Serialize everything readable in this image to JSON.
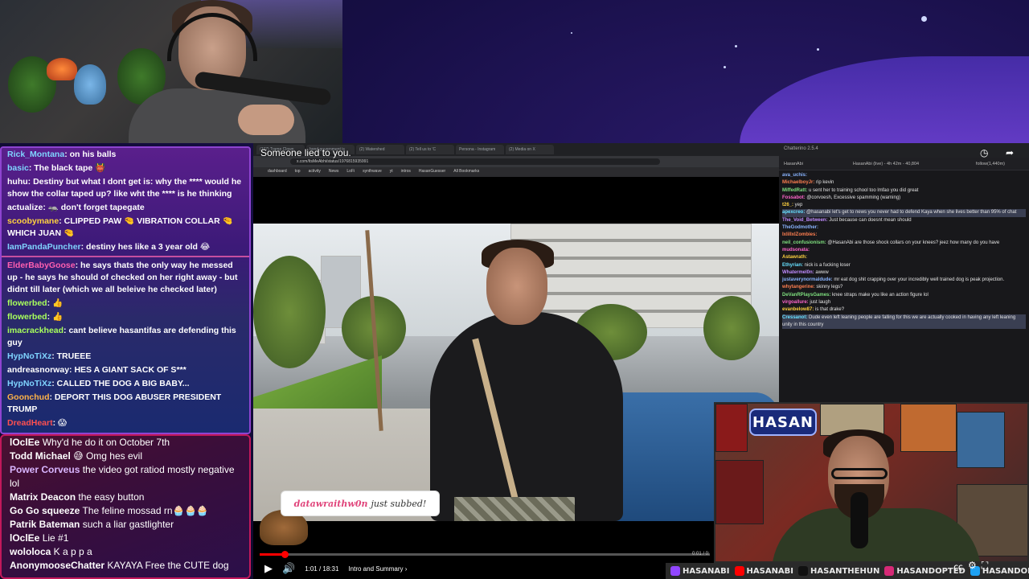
{
  "stream": {
    "video_title_overlay": "Someone lied to you."
  },
  "chat_left": {
    "messages": [
      {
        "user": "Rick_Montana",
        "color": "#7fd4ff",
        "text": "on his balls"
      },
      {
        "user": "basic",
        "color": "#7fd4ff",
        "text": "The black tape 👹"
      },
      {
        "user": "huhu",
        "color": "#ffffff",
        "text": "Destiny but what I dont get is: why the **** would he show the collar taped up? like wht the **** is he thinking"
      },
      {
        "user": "actualize",
        "color": "#ffffff",
        "text": "🦡 don't forget tapegate"
      },
      {
        "user": "scoobymane",
        "color": "#ffd23f",
        "text": "CLIPPED PAW 🤏 VIBRATION COLLAR 🤏 WHICH JUAN 🤏"
      },
      {
        "user": "IamPandaPuncher",
        "color": "#7fd4ff",
        "text": "destiny hes like a 3 year old 😂"
      },
      {
        "user": "ElderBabyGoose",
        "color": "#ff5fb0",
        "text": "he says thats the only way he messed up - he says he should of checked on her right away - but didnt till later (which we all beleive he checked later)"
      },
      {
        "user": "flowerbed",
        "color": "#a8ff5c",
        "text": "👍"
      },
      {
        "user": "flowerbed",
        "color": "#a8ff5c",
        "text": "👍"
      },
      {
        "user": "imacrackhead",
        "color": "#a8ff5c",
        "text": "cant believe hasantifas are defending this guy"
      },
      {
        "user": "HypNoTiXz",
        "color": "#7fd4ff",
        "text": "TRUEEE"
      },
      {
        "user": "andreasnorway",
        "color": "#ffffff",
        "text": "HES A GIANT SACK OF S***"
      },
      {
        "user": "HypNoTiXz",
        "color": "#7fd4ff",
        "text": "CALLED THE DOG A BIG BABY..."
      },
      {
        "user": "Goonchud",
        "color": "#ffb347",
        "text": "DEPORT THIS DOG ABUSER PRESIDENT TRUMP"
      },
      {
        "user": "DreadHeart",
        "color": "#ff5050",
        "text": "😱"
      }
    ]
  },
  "chat_bottom_left": {
    "messages": [
      {
        "user": "lOclEe",
        "color": "#ffffff",
        "text": "Why'd he do it on October 7th"
      },
      {
        "user": "Todd Michael",
        "color": "#ffffff",
        "text": "😅 Omg hes evil"
      },
      {
        "user": "Power Corveus",
        "color": "#d9b6ff",
        "text": "the video got ratiod mostly negative lol"
      },
      {
        "user": "Matrix Deacon",
        "color": "#ffffff",
        "text": "the easy button"
      },
      {
        "user": "Go Go squeeze",
        "color": "#ffffff",
        "text": "The feline mossad rn🧁🧁🧁"
      },
      {
        "user": "Patrik Bateman",
        "color": "#ffffff",
        "text": "such a liar gastlighter"
      },
      {
        "user": "lOclEe",
        "color": "#ffffff",
        "text": "Lie #1"
      },
      {
        "user": "wololoca",
        "color": "#ffffff",
        "text": "K a p p a"
      },
      {
        "user": "AnonymooseChatter",
        "color": "#ffffff",
        "text": "KAYAYA Free the CUTE dog"
      }
    ]
  },
  "browser": {
    "tabs": [
      "(777) Tramp Clown",
      "bond government is",
      "(2) Watershed",
      "(2) Tell us to 'C",
      "Persona - Instagram",
      "(2) Media on X"
    ],
    "address": "x.com/ItsMeAbhi/status/1976815935991",
    "bookmarks": [
      "dashboard",
      "top",
      "activity",
      "News",
      "LoFi",
      "synthwave",
      "yt",
      "intros",
      "HasanGuesser",
      "All Bookmarks"
    ]
  },
  "alert": {
    "subscriber": "datawraithw0n",
    "text": "just subbed!"
  },
  "player": {
    "current_time": "1:01",
    "duration": "18:31",
    "time_label": "1:01 / 18:31",
    "chapter": "Intro and Summary",
    "progress_fraction": 0.055,
    "right_time": "0:01 / 0:"
  },
  "chat_right": {
    "topbar": "Chatterino 2.5.4",
    "header": {
      "channel": "HasanAbi",
      "live_text": "HasanAbi (live) - 4h 42m - 40,804",
      "follow": "follow(1,440m)"
    },
    "messages": [
      {
        "user": "ava_uchis",
        "text": ""
      },
      {
        "user": "MichaelboyJr",
        "text": "rip kevin"
      },
      {
        "user": "MiffedRatt",
        "text": "u sent her to training school too lmfao you did great"
      },
      {
        "user": "Fossabot",
        "text": "@corvoesh, Excessive spamming (warning)"
      },
      {
        "user": "t26_",
        "text": "yep"
      },
      {
        "user": "apexcreo",
        "text": "@hasanabi let's get to news you never had to defend Kaya when she lives better than 95% of chat"
      },
      {
        "user": "The_Void_Between",
        "text": "Just because can doesnt mean should"
      },
      {
        "user": "TheGodmother",
        "text": ""
      },
      {
        "user": "IxIillxIZombies",
        "text": ""
      },
      {
        "user": "neil_confusionism",
        "text": "@HasanAbi are those shock collars on your knees? jeez how many do you have"
      },
      {
        "user": "mudsonata",
        "text": ""
      },
      {
        "user": "Astawrath",
        "text": ""
      },
      {
        "user": "Ethyrian",
        "text": "nick is a fucking loser"
      },
      {
        "user": "Whatermel0n",
        "text": "awww"
      },
      {
        "user": "justaverynormaldude",
        "text": "mr eat dog shit crapping over your incredibly well trained dog is peak projection."
      },
      {
        "user": "whytangerine",
        "text": "skinny legs?"
      },
      {
        "user": "DeVanRPlaysGames",
        "text": "knee straps make you like an action figure lol"
      },
      {
        "user": "virgoallure",
        "text": "just laugh"
      },
      {
        "user": "evanbelow87",
        "text": "is that drake?"
      },
      {
        "user": "Cressanot",
        "text": "Dude even left leaning people are falling for this we are actually cooked in having any left leaning unity in this country"
      }
    ]
  },
  "webcam_logo": "HASAN",
  "socials": [
    {
      "name": "HASANABI",
      "platform": "twitch",
      "color": "#9146ff"
    },
    {
      "name": "HASANABI",
      "platform": "youtube",
      "color": "#ff0000"
    },
    {
      "name": "HASANTHEHUN",
      "platform": "tiktok",
      "color": "#111111"
    },
    {
      "name": "HASANDOPTED",
      "platform": "instagram",
      "color": "#d62976"
    },
    {
      "name": "HASANDOPTED",
      "platform": "x",
      "color": "#1da1f2"
    }
  ]
}
